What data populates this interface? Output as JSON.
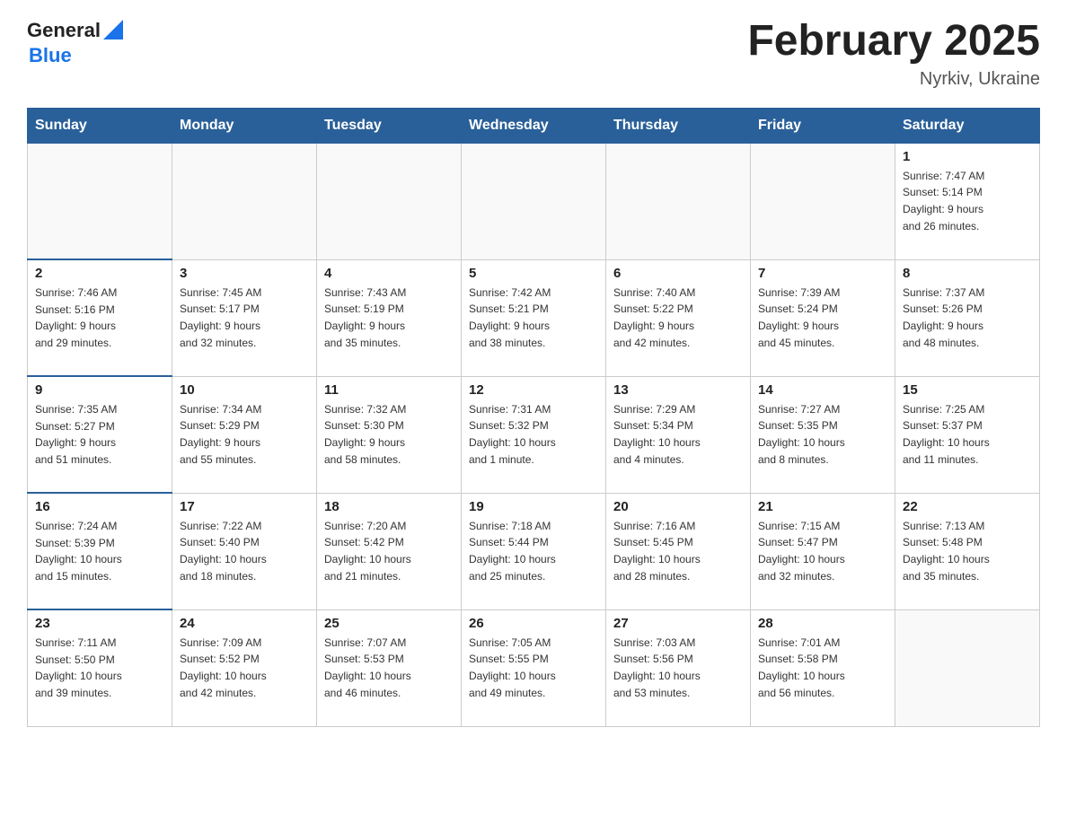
{
  "header": {
    "logo_general": "General",
    "logo_blue": "Blue",
    "title": "February 2025",
    "subtitle": "Nyrkiv, Ukraine"
  },
  "days_of_week": [
    "Sunday",
    "Monday",
    "Tuesday",
    "Wednesday",
    "Thursday",
    "Friday",
    "Saturday"
  ],
  "weeks": [
    [
      {
        "day": "",
        "info": ""
      },
      {
        "day": "",
        "info": ""
      },
      {
        "day": "",
        "info": ""
      },
      {
        "day": "",
        "info": ""
      },
      {
        "day": "",
        "info": ""
      },
      {
        "day": "",
        "info": ""
      },
      {
        "day": "1",
        "info": "Sunrise: 7:47 AM\nSunset: 5:14 PM\nDaylight: 9 hours\nand 26 minutes."
      }
    ],
    [
      {
        "day": "2",
        "info": "Sunrise: 7:46 AM\nSunset: 5:16 PM\nDaylight: 9 hours\nand 29 minutes."
      },
      {
        "day": "3",
        "info": "Sunrise: 7:45 AM\nSunset: 5:17 PM\nDaylight: 9 hours\nand 32 minutes."
      },
      {
        "day": "4",
        "info": "Sunrise: 7:43 AM\nSunset: 5:19 PM\nDaylight: 9 hours\nand 35 minutes."
      },
      {
        "day": "5",
        "info": "Sunrise: 7:42 AM\nSunset: 5:21 PM\nDaylight: 9 hours\nand 38 minutes."
      },
      {
        "day": "6",
        "info": "Sunrise: 7:40 AM\nSunset: 5:22 PM\nDaylight: 9 hours\nand 42 minutes."
      },
      {
        "day": "7",
        "info": "Sunrise: 7:39 AM\nSunset: 5:24 PM\nDaylight: 9 hours\nand 45 minutes."
      },
      {
        "day": "8",
        "info": "Sunrise: 7:37 AM\nSunset: 5:26 PM\nDaylight: 9 hours\nand 48 minutes."
      }
    ],
    [
      {
        "day": "9",
        "info": "Sunrise: 7:35 AM\nSunset: 5:27 PM\nDaylight: 9 hours\nand 51 minutes."
      },
      {
        "day": "10",
        "info": "Sunrise: 7:34 AM\nSunset: 5:29 PM\nDaylight: 9 hours\nand 55 minutes."
      },
      {
        "day": "11",
        "info": "Sunrise: 7:32 AM\nSunset: 5:30 PM\nDaylight: 9 hours\nand 58 minutes."
      },
      {
        "day": "12",
        "info": "Sunrise: 7:31 AM\nSunset: 5:32 PM\nDaylight: 10 hours\nand 1 minute."
      },
      {
        "day": "13",
        "info": "Sunrise: 7:29 AM\nSunset: 5:34 PM\nDaylight: 10 hours\nand 4 minutes."
      },
      {
        "day": "14",
        "info": "Sunrise: 7:27 AM\nSunset: 5:35 PM\nDaylight: 10 hours\nand 8 minutes."
      },
      {
        "day": "15",
        "info": "Sunrise: 7:25 AM\nSunset: 5:37 PM\nDaylight: 10 hours\nand 11 minutes."
      }
    ],
    [
      {
        "day": "16",
        "info": "Sunrise: 7:24 AM\nSunset: 5:39 PM\nDaylight: 10 hours\nand 15 minutes."
      },
      {
        "day": "17",
        "info": "Sunrise: 7:22 AM\nSunset: 5:40 PM\nDaylight: 10 hours\nand 18 minutes."
      },
      {
        "day": "18",
        "info": "Sunrise: 7:20 AM\nSunset: 5:42 PM\nDaylight: 10 hours\nand 21 minutes."
      },
      {
        "day": "19",
        "info": "Sunrise: 7:18 AM\nSunset: 5:44 PM\nDaylight: 10 hours\nand 25 minutes."
      },
      {
        "day": "20",
        "info": "Sunrise: 7:16 AM\nSunset: 5:45 PM\nDaylight: 10 hours\nand 28 minutes."
      },
      {
        "day": "21",
        "info": "Sunrise: 7:15 AM\nSunset: 5:47 PM\nDaylight: 10 hours\nand 32 minutes."
      },
      {
        "day": "22",
        "info": "Sunrise: 7:13 AM\nSunset: 5:48 PM\nDaylight: 10 hours\nand 35 minutes."
      }
    ],
    [
      {
        "day": "23",
        "info": "Sunrise: 7:11 AM\nSunset: 5:50 PM\nDaylight: 10 hours\nand 39 minutes."
      },
      {
        "day": "24",
        "info": "Sunrise: 7:09 AM\nSunset: 5:52 PM\nDaylight: 10 hours\nand 42 minutes."
      },
      {
        "day": "25",
        "info": "Sunrise: 7:07 AM\nSunset: 5:53 PM\nDaylight: 10 hours\nand 46 minutes."
      },
      {
        "day": "26",
        "info": "Sunrise: 7:05 AM\nSunset: 5:55 PM\nDaylight: 10 hours\nand 49 minutes."
      },
      {
        "day": "27",
        "info": "Sunrise: 7:03 AM\nSunset: 5:56 PM\nDaylight: 10 hours\nand 53 minutes."
      },
      {
        "day": "28",
        "info": "Sunrise: 7:01 AM\nSunset: 5:58 PM\nDaylight: 10 hours\nand 56 minutes."
      },
      {
        "day": "",
        "info": ""
      }
    ]
  ]
}
